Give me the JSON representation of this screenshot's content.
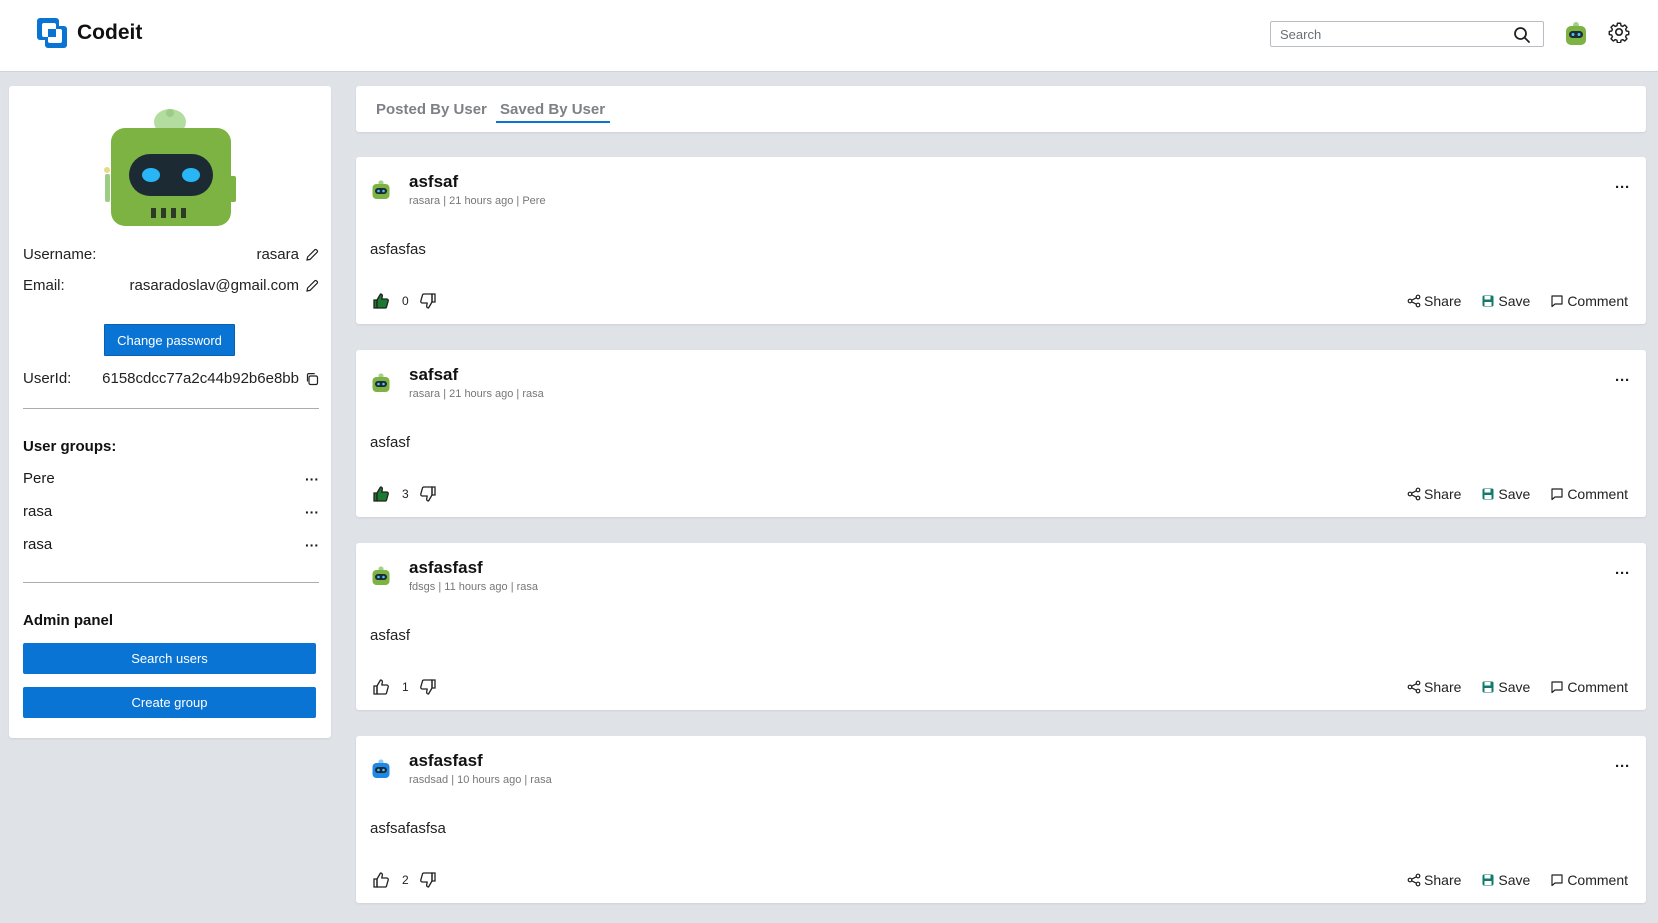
{
  "app": {
    "name": "Codeit"
  },
  "search": {
    "placeholder": "Search",
    "value": ""
  },
  "profile": {
    "username_label": "Username:",
    "username": "rasara",
    "email_label": "Email:",
    "email": "rasaradoslav@gmail.com",
    "change_password": "Change password",
    "userid_label": "UserId:",
    "userid": "6158cdcc77a2c44b92b6e8bb",
    "groups_title": "User groups:",
    "groups": [
      "Pere",
      "rasa",
      "rasa"
    ],
    "group_more": "···",
    "admin_title": "Admin panel",
    "search_users": "Search users",
    "create_group": "Create group"
  },
  "tabs": {
    "posted": "Posted By User",
    "saved": "Saved By User",
    "active": "saved"
  },
  "post_actions": {
    "share": "Share",
    "save": "Save",
    "comment": "Comment",
    "more": "···"
  },
  "posts": [
    {
      "title": "asfsaf",
      "meta": "rasara | 21 hours ago | Pere",
      "body": "asfasfas",
      "votes": "0",
      "liked": true,
      "avatar_color": "green"
    },
    {
      "title": "safsaf",
      "meta": "rasara | 21 hours ago | rasa",
      "body": "asfasf",
      "votes": "3",
      "liked": true,
      "avatar_color": "green"
    },
    {
      "title": "asfasfasf",
      "meta": "fdsgs | 11 hours ago | rasa",
      "body": "asfasf",
      "votes": "1",
      "liked": false,
      "avatar_color": "green"
    },
    {
      "title": "asfasfasf",
      "meta": "rasdsad | 10 hours ago | rasa",
      "body": "asfsafasfsa",
      "votes": "2",
      "liked": false,
      "avatar_color": "blue"
    }
  ],
  "colors": {
    "accent": "#0a74d4",
    "avatar_green": "#7cb342",
    "avatar_blue": "#1e88e5",
    "like_green": "#1b7a2f"
  }
}
